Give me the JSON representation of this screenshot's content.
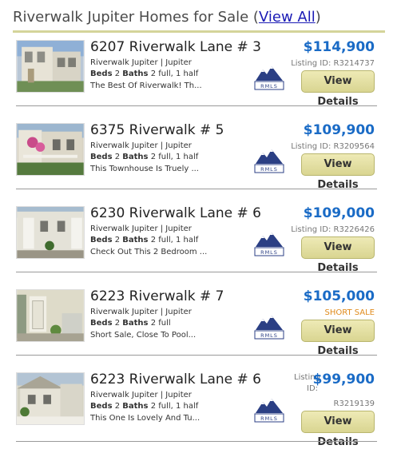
{
  "header": {
    "title": "Riverwalk Jupiter Homes for Sale",
    "open_paren": " (",
    "link": "View All",
    "close_paren": ")"
  },
  "common": {
    "beds_label": "Beds",
    "baths_label": "Baths",
    "button_label": "View Details",
    "rmls_logo_text": "RMLS"
  },
  "colors": {
    "price": "#1a6bc6",
    "short_sale": "#e08a1a",
    "button_bg": "#e4e0a4",
    "divider": "#9a9a9a"
  },
  "listings": [
    {
      "address": "6207 Riverwalk Lane # 3",
      "community": "Riverwalk Jupiter | Jupiter",
      "beds": "2",
      "baths": "2 full, 1 half",
      "description": "The Best Of Riverwalk! Th...",
      "price": "$114,900",
      "listing_id": "Listing ID: R3214737"
    },
    {
      "address": "6375 Riverwalk # 5",
      "community": "Riverwalk Jupiter | Jupiter",
      "beds": "2",
      "baths": "2 full, 1 half",
      "description": "This Townhouse Is Truely ...",
      "price": "$109,900",
      "listing_id": "Listing ID: R3209564"
    },
    {
      "address": "6230 Riverwalk Lane # 6",
      "community": "Riverwalk Jupiter | Jupiter",
      "beds": "2",
      "baths": "2 full, 1 half",
      "description": "Check Out This 2 Bedroom ...",
      "price": "$109,000",
      "listing_id": "Listing ID: R3226426"
    },
    {
      "address": "6223 Riverwalk # 7",
      "community": "Riverwalk Jupiter | Jupiter",
      "beds": "2",
      "baths": "2 full",
      "description": "Short Sale, Close To Pool...",
      "price": "$105,000",
      "status": "SHORT SALE"
    },
    {
      "address": "6223 Riverwalk Lane # 6",
      "community": "Riverwalk Jupiter | Jupiter",
      "beds": "2",
      "baths": "2 full, 1 half",
      "description": "This One Is Lovely And Tu...",
      "price": "$99,900",
      "listing_label_1": "Listing",
      "listing_label_2": "ID:",
      "listing_number": "R3219139"
    }
  ]
}
